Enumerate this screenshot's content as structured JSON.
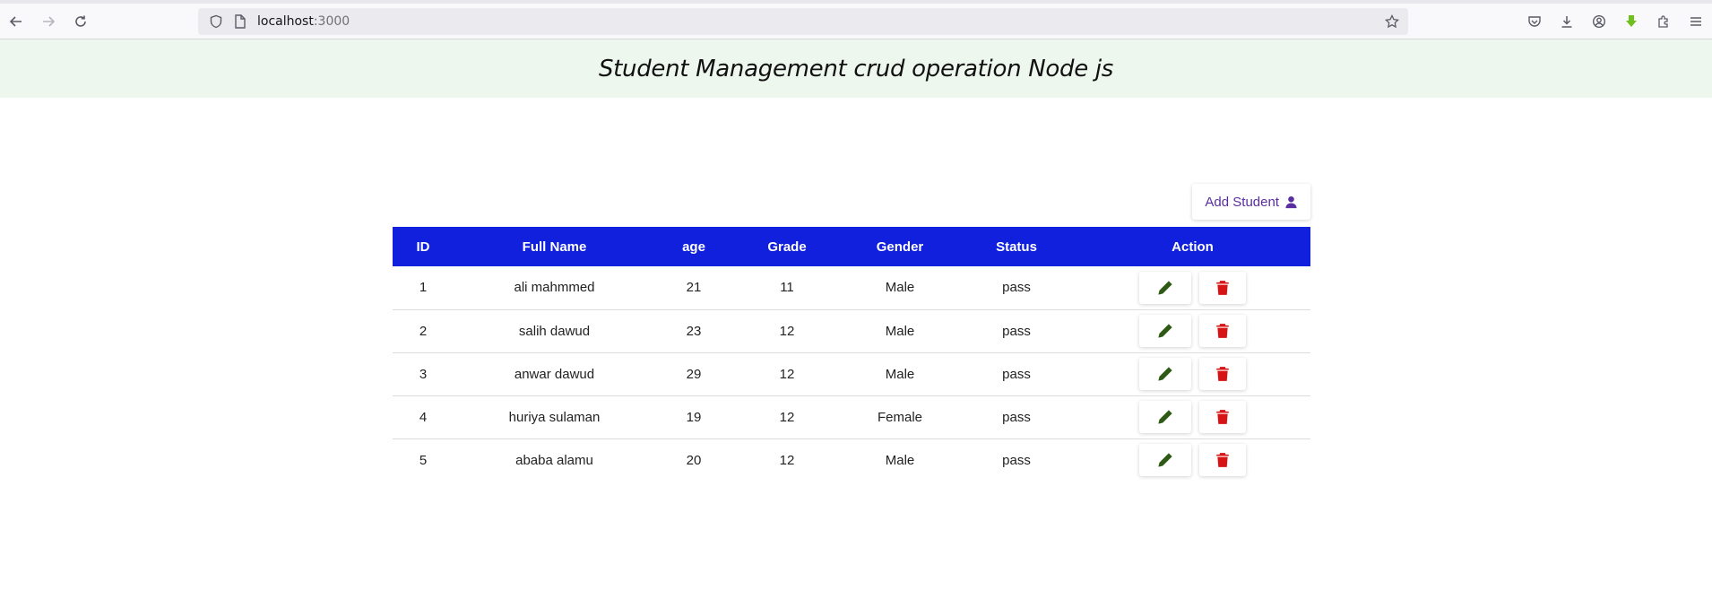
{
  "browser": {
    "url_host": "localhost",
    "url_port": ":3000"
  },
  "header": {
    "title": "Student Management crud operation Node js"
  },
  "toolbar": {
    "add_label": "Add Student"
  },
  "table": {
    "columns": [
      "ID",
      "Full Name",
      "age",
      "Grade",
      "Gender",
      "Status",
      "Action"
    ],
    "rows": [
      {
        "id": "1",
        "name": "ali mahmmed",
        "age": "21",
        "grade": "11",
        "gender": "Male",
        "status": "pass"
      },
      {
        "id": "2",
        "name": "salih dawud",
        "age": "23",
        "grade": "12",
        "gender": "Male",
        "status": "pass"
      },
      {
        "id": "3",
        "name": "anwar dawud",
        "age": "29",
        "grade": "12",
        "gender": "Male",
        "status": "pass"
      },
      {
        "id": "4",
        "name": "huriya sulaman",
        "age": "19",
        "grade": "12",
        "gender": "Female",
        "status": "pass"
      },
      {
        "id": "5",
        "name": "ababa alamu",
        "age": "20",
        "grade": "12",
        "gender": "Male",
        "status": "pass"
      }
    ]
  },
  "colors": {
    "header_bg": "#1020dc",
    "banner_bg": "#eef7ee",
    "edit_icon": "#2e5a16",
    "delete_icon": "#d81313",
    "add_button_text": "#5a2ea0"
  },
  "icons": {
    "back": "back-arrow-icon",
    "forward": "forward-arrow-icon",
    "reload": "reload-icon",
    "edit": "pencil-icon",
    "delete": "trash-icon",
    "add": "user-icon"
  }
}
